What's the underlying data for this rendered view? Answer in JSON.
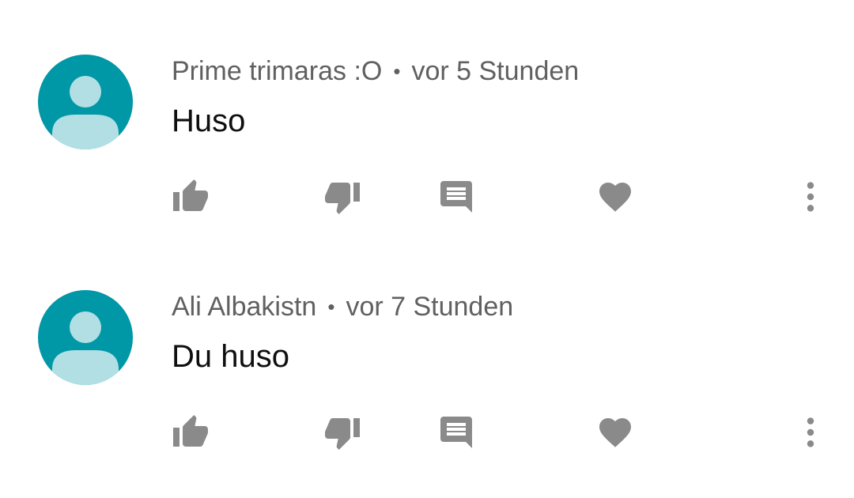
{
  "colors": {
    "avatar_bg": "#0097A7",
    "avatar_fg": "#B2DFE4",
    "meta_text": "#606060",
    "body_text": "#0f0f0f",
    "icon": "#8a8a8a"
  },
  "comments": [
    {
      "author": "Prime trimaras :O",
      "separator": "•",
      "time": "vor 5 Stunden",
      "text": "Huso",
      "avatar_icon": "default-user-avatar-icon",
      "actions": [
        "thumbs-up-icon",
        "thumbs-down-icon",
        "reply-icon",
        "heart-icon",
        "more-vert-icon"
      ]
    },
    {
      "author": "Ali Albakistn",
      "separator": "•",
      "time": "vor 7 Stunden",
      "text": "Du huso",
      "avatar_icon": "default-user-avatar-icon",
      "actions": [
        "thumbs-up-icon",
        "thumbs-down-icon",
        "reply-icon",
        "heart-icon",
        "more-vert-icon"
      ]
    }
  ]
}
